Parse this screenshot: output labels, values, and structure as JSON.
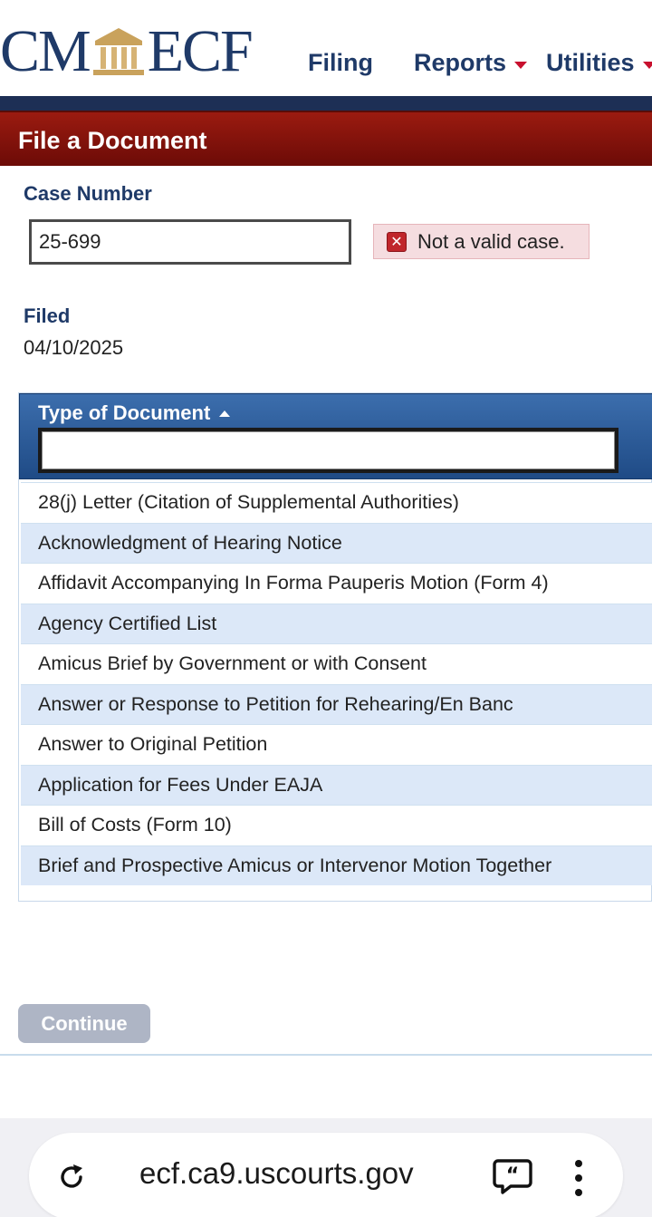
{
  "header": {
    "logo_left": "CM",
    "logo_right": "ECF",
    "nav": [
      {
        "label": "Filing",
        "has_menu": false
      },
      {
        "label": "Reports",
        "has_menu": true
      },
      {
        "label": "Utilities",
        "has_menu": true
      }
    ]
  },
  "page": {
    "title": "File a Document"
  },
  "case": {
    "label": "Case Number",
    "value": "25-699",
    "error": "Not a valid case."
  },
  "filed": {
    "label": "Filed",
    "value": "04/10/2025"
  },
  "documents": {
    "header": "Type of Document",
    "filter_value": "",
    "items": [
      "28(j) Letter (Citation of Supplemental Authorities)",
      "Acknowledgment of Hearing Notice",
      "Affidavit Accompanying In Forma Pauperis Motion (Form 4)",
      "Agency Certified List",
      "Amicus Brief by Government or with Consent",
      "Answer or Response to Petition for Rehearing/En Banc",
      "Answer to Original Petition",
      "Application for Fees Under EAJA",
      "Bill of Costs (Form 10)",
      "Brief and Prospective Amicus or Intervenor Motion Together"
    ]
  },
  "actions": {
    "continue_label": "Continue"
  },
  "browser": {
    "url": "ecf.ca9.uscourts.gov"
  },
  "colors": {
    "brand_navy": "#1f3a68",
    "title_red": "#8a1410",
    "accent_caret": "#c8102e",
    "error_bg": "#f5dde0",
    "row_alt": "#dce8f8"
  }
}
